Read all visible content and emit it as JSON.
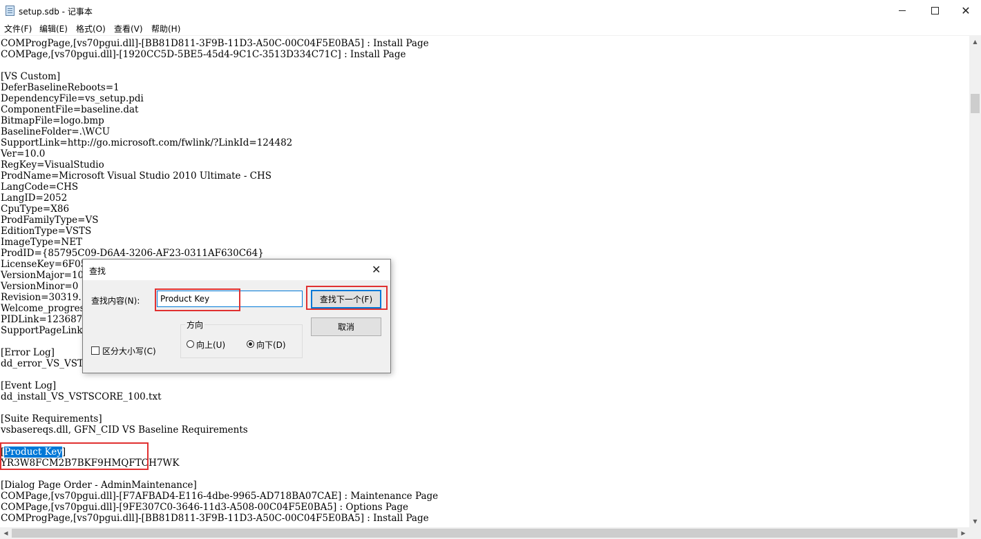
{
  "window": {
    "title": "setup.sdb - 记事本",
    "min_glyph": "",
    "max_glyph": "",
    "close_glyph": "✕"
  },
  "menu": [
    {
      "label": "文件(F)"
    },
    {
      "label": "编辑(E)"
    },
    {
      "label": "格式(O)"
    },
    {
      "label": "查看(V)"
    },
    {
      "label": "帮助(H)"
    }
  ],
  "editor": {
    "lines": [
      "COMProgPage,[vs70pgui.dll]-[BB81D811-3F9B-11D3-A50C-00C04F5E0BA5] : Install Page",
      "COMPage,[vs70pgui.dll]-[1920CC5D-5BE5-45d4-9C1C-3513D334C71C] : Install Page",
      "",
      "[VS Custom]",
      "DeferBaselineReboots=1",
      "DependencyFile=vs_setup.pdi",
      "ComponentFile=baseline.dat",
      "BitmapFile=logo.bmp",
      "BaselineFolder=.\\WCU",
      "SupportLink=http://go.microsoft.com/fwlink/?LinkId=124482",
      "Ver=10.0",
      "RegKey=VisualStudio",
      "ProdName=Microsoft Visual Studio 2010 Ultimate - CHS",
      "LangCode=CHS",
      "LangID=2052",
      "CpuType=X86",
      "ProdFamilyType=VS",
      "EditionType=VSTS",
      "ImageType=NET",
      "ProdID={85795C09-D6A4-3206-AF23-0311AF630C64}",
      "LicenseKey=6F05",
      "VersionMajor=10",
      "VersionMinor=0",
      "Revision=30319.",
      "Welcome_progres",
      "PIDLink=123687",
      "SupportPageLink",
      "",
      "[Error Log]",
      "dd_error_VS_VST",
      "",
      "[Event Log]",
      "dd_install_VS_VSTSCORE_100.txt",
      "",
      "[Suite Requirements]",
      "vsbasereqs.dll, GFN_CID VS Baseline Requirements",
      "",
      "",
      "YR3W8FCM2B7BKF9HMQFTCH7WK",
      "",
      "[Dialog Page Order - AdminMaintenance]",
      "COMPage,[vs70pgui.dll]-[F7AFBAD4-E116-4dbe-9965-AD718BA07CAE] : Maintenance Page",
      "COMPage,[vs70pgui.dll]-[9FE307C0-3646-11d3-A508-00C04F5E0BA5] : Options Page",
      "COMProgPage,[vs70pgui.dll]-[BB81D811-3F9B-11D3-A50C-00C04F5E0BA5] : Install Page"
    ],
    "selected_line": {
      "open": "[",
      "selected": "Product Key",
      "close": "]"
    }
  },
  "find_dialog": {
    "title": "查找",
    "close_glyph": "✕",
    "find_label": "查找内容(N):",
    "find_value": "Product Key",
    "find_next_button": "查找下一个(F)",
    "cancel_button": "取消",
    "direction_label": "方向",
    "up_label": "向上(U)",
    "down_label": "向下(D)",
    "direction_selected": "down",
    "match_case_label": "区分大小写(C)",
    "match_case_checked": false
  },
  "scrollbar": {
    "up_arrow": "▲",
    "down_arrow": "▼",
    "left_arrow": "◀",
    "right_arrow": "▶"
  },
  "colors": {
    "selection": "#0078d7",
    "highlight_box": "#e03030"
  }
}
